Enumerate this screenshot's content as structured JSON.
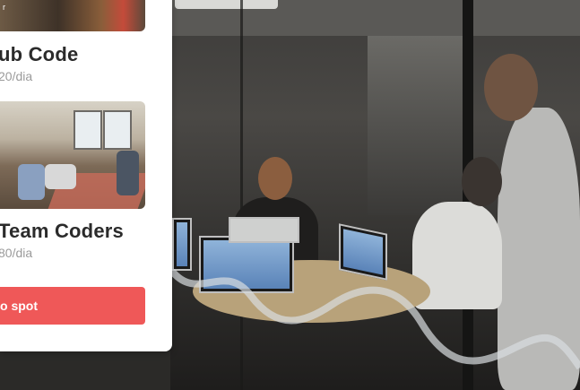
{
  "card": {
    "top_label": "r",
    "spaces": [
      {
        "name": "ub Code",
        "price": "20/dia"
      },
      {
        "name": "Team Coders",
        "price": "80/dia"
      }
    ],
    "button_label": "o spot"
  },
  "colors": {
    "accent": "#ef5858",
    "title": "#2b2b2b",
    "price": "#9a9a9a",
    "card": "#ffffff"
  }
}
